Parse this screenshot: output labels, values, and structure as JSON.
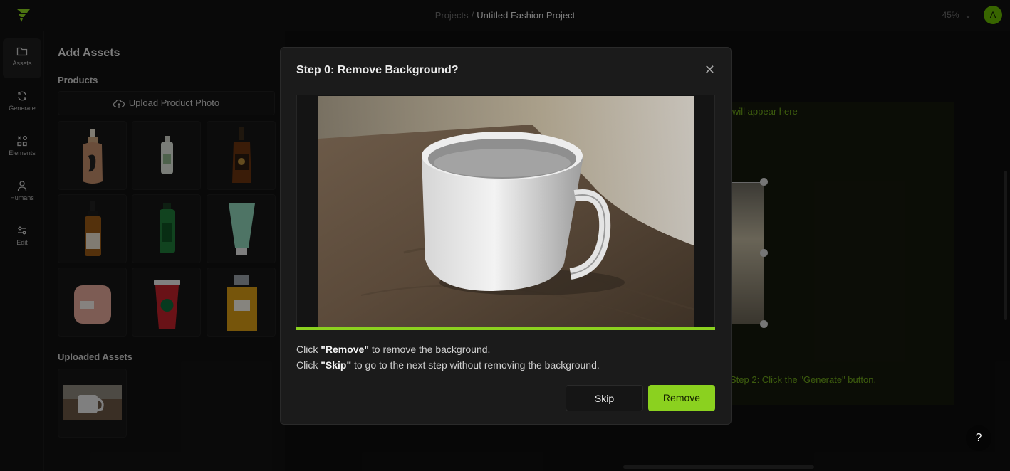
{
  "header": {
    "breadcrumb_parent": "Projects",
    "breadcrumb_sep": "/",
    "project_name": "Untitled Fashion Project",
    "zoom": "45%",
    "avatar_initial": "A"
  },
  "rail": {
    "items": [
      {
        "label": "Assets",
        "icon": "folder-icon"
      },
      {
        "label": "Generate",
        "icon": "refresh-icon"
      },
      {
        "label": "Elements",
        "icon": "shapes-icon"
      },
      {
        "label": "Humans",
        "icon": "person-icon"
      },
      {
        "label": "Edit",
        "icon": "sliders-icon"
      }
    ]
  },
  "panel": {
    "title": "Add Assets",
    "products_heading": "Products",
    "upload_label": "Upload Product Photo",
    "uploaded_heading": "Uploaded Assets",
    "products": [
      "dropper-bottle",
      "small-white-bottle",
      "whiskey-bottle",
      "serum-bottle",
      "green-bottle",
      "mint-tube",
      "pink-candle",
      "red-cup",
      "perfume-bottle"
    ]
  },
  "canvas": {
    "placeholder_top": "will appear here",
    "placeholder_bottom": "Step 2: Click the \"Generate\" button."
  },
  "modal": {
    "title": "Step 0: Remove Background?",
    "line1_pre": "Click ",
    "line1_bold": "\"Remove\"",
    "line1_post": " to remove the background.",
    "line2_pre": "Click ",
    "line2_bold": "\"Skip\"",
    "line2_post": " to go to the next step without removing the background.",
    "skip_label": "Skip",
    "remove_label": "Remove",
    "progress": 1.0
  },
  "help_label": "?",
  "colors": {
    "accent": "#8bd11f",
    "avatar_bg": "#66b800",
    "placeholder_text": "#6fa81a"
  }
}
